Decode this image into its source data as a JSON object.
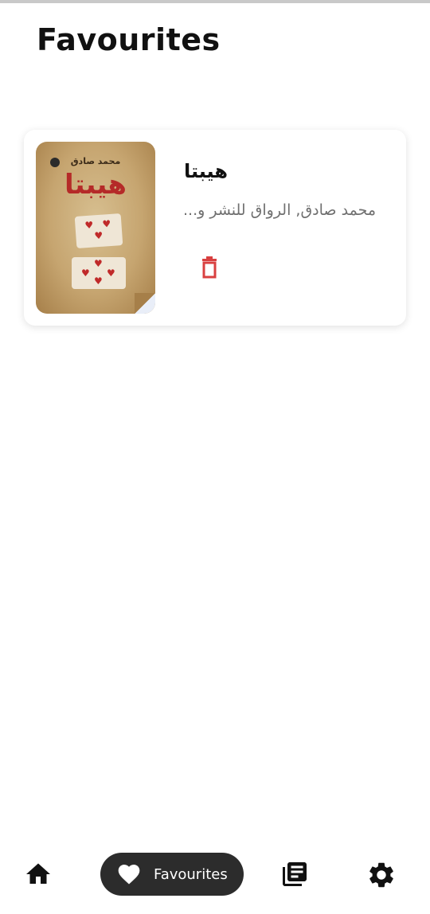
{
  "header": {
    "title": "Favourites"
  },
  "favourites": [
    {
      "title": "هيبتا",
      "author": "محمد صادق, الرواق للنشر و...",
      "cover": {
        "author_text": "محمد صادق",
        "title_text": "هيبتا"
      }
    }
  ],
  "nav": {
    "items": [
      {
        "icon": "home-icon",
        "label": ""
      },
      {
        "icon": "heart-icon",
        "label": "Favourites",
        "active": true
      },
      {
        "icon": "library-icon",
        "label": ""
      },
      {
        "icon": "gear-icon",
        "label": ""
      }
    ]
  },
  "colors": {
    "delete": "#d94040",
    "active_pill": "#2c2c2c",
    "author_text": "#707070"
  }
}
